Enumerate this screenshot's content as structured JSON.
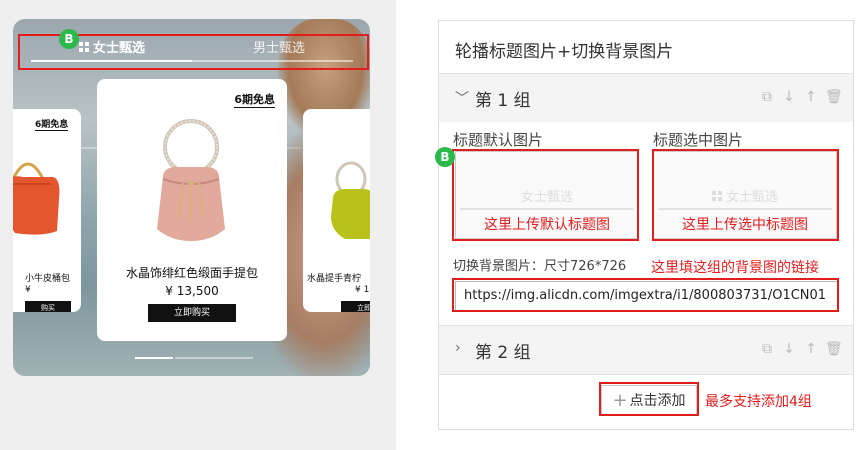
{
  "preview": {
    "tab_active": "女士甄选",
    "tab_inactive": "男士甄选",
    "badge": "B",
    "main_card": {
      "installment": "6期免息",
      "product_name": "水晶饰绯红色缎面手提包",
      "price": "¥ 13,500",
      "buy_label": "立即购买"
    },
    "left_card": {
      "installment": "6期免息",
      "product_name": "小牛皮桶包",
      "price": "¥",
      "buy_label": "购买"
    },
    "right_card": {
      "product_name": "水晶提手青柠",
      "price": "¥ 1",
      "buy_label": "立即"
    }
  },
  "panel": {
    "title": "轮播标题图片+切换背景图片",
    "group1": {
      "label": "第 1 组",
      "default_image_label": "标题默认图片",
      "selected_image_label": "标题选中图片",
      "default_ghost_text": "女士甄选",
      "selected_ghost_text": "女士甄选",
      "default_upload_note": "这里上传默认标题图",
      "selected_upload_note": "这里上传选中标题图",
      "bg_label": "切换背景图片：尺寸726*726",
      "bg_note": "这里填这组的背景图的链接",
      "bg_url": "https://img.alicdn.com/imgextra/i1/800803731/O1CN01"
    },
    "group2": {
      "label": "第 2 组"
    },
    "add_button": "点击添加",
    "add_note": "最多支持添加4组",
    "badge": "B"
  },
  "colors": {
    "annotation_red": "#e01e1e",
    "badge_green": "#2db84d",
    "button_black": "#111111"
  }
}
